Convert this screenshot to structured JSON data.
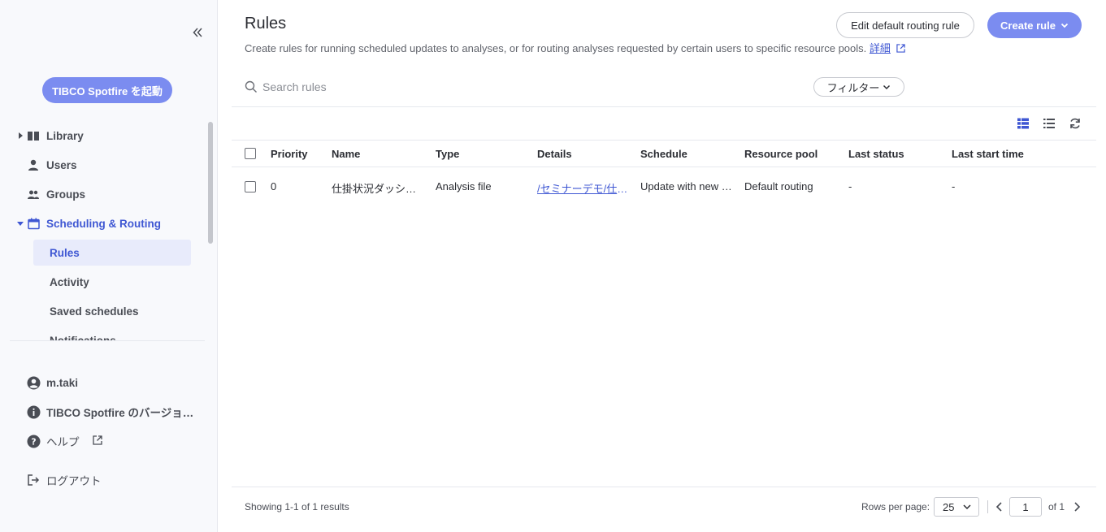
{
  "sidebar": {
    "launch_label": "TIBCO Spotfire を起動",
    "nav": [
      {
        "label": "Library",
        "icon": "book-icon"
      },
      {
        "label": "Users",
        "icon": "user-icon"
      },
      {
        "label": "Groups",
        "icon": "group-icon"
      },
      {
        "label": "Scheduling & Routing",
        "icon": "calendar-icon"
      }
    ],
    "sub": [
      {
        "label": "Rules"
      },
      {
        "label": "Activity"
      },
      {
        "label": "Saved schedules"
      },
      {
        "label": "Notifications"
      }
    ],
    "bottom": {
      "user": "m.taki",
      "version": "TIBCO Spotfire のバージョ…",
      "help": "ヘルプ",
      "logout": "ログアウト"
    }
  },
  "header": {
    "title": "Rules",
    "description": "Create rules for running scheduled updates to analyses, or for routing analyses requested by certain users to specific resource pools.",
    "details_link": "詳細",
    "edit_default_label": "Edit default routing rule",
    "create_rule_label": "Create rule"
  },
  "toolbar": {
    "search_placeholder": "Search rules",
    "filter_label": "フィルター"
  },
  "table": {
    "columns": [
      "Priority",
      "Name",
      "Type",
      "Details",
      "Schedule",
      "Resource pool",
      "Last status",
      "Last start time"
    ],
    "rows": [
      {
        "priority": "0",
        "name": "仕掛状況ダッシ…",
        "type": "Analysis file",
        "details": "/セミナーデモ/仕掛…",
        "schedule": "Update with new …",
        "resource_pool": "Default routing",
        "last_status": "-",
        "last_start_time": "-"
      }
    ]
  },
  "footer": {
    "showing": "Showing 1-1 of 1 results",
    "rows_per_page_label": "Rows per page:",
    "rows_per_page_value": "25",
    "page_value": "1",
    "of_label": "of 1"
  },
  "colors": {
    "accent": "#3f57d3",
    "button_primary": "#7b8cf0",
    "selected_bg": "#e8ebfb"
  }
}
